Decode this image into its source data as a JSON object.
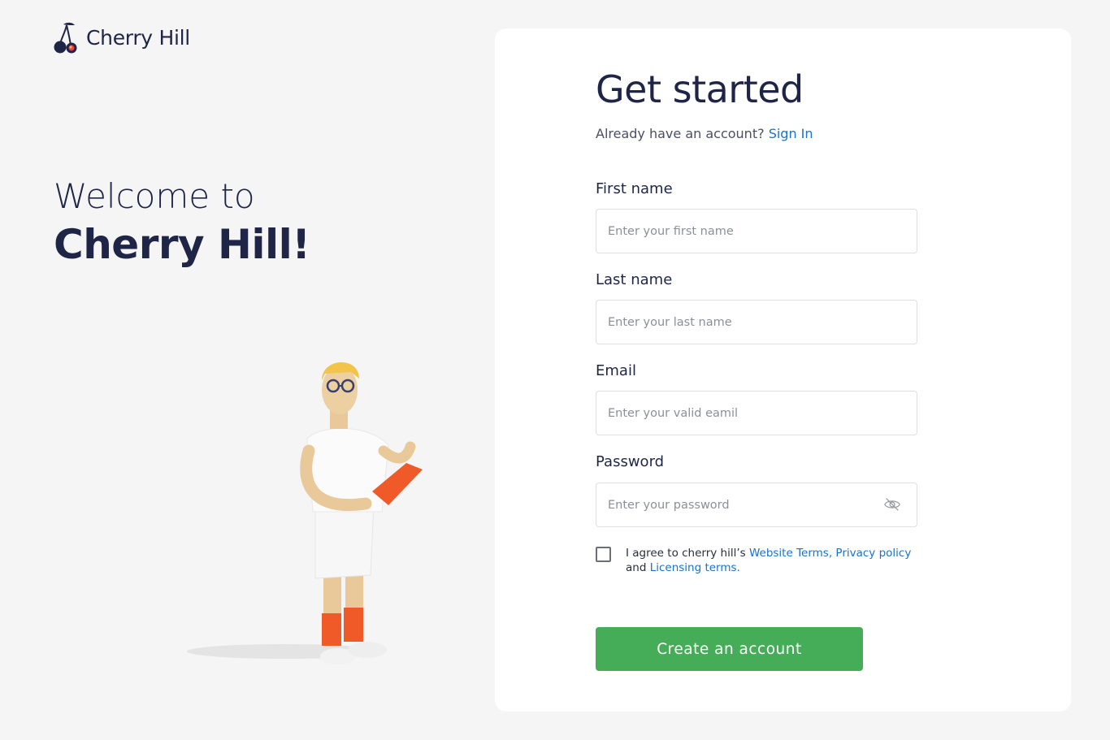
{
  "brand": {
    "name": "Cherry Hill"
  },
  "welcome": {
    "line1": "Welcome to",
    "line2": "Cherry Hill!"
  },
  "form": {
    "title": "Get started",
    "signin_prompt": "Already have an account?",
    "signin_link": "Sign In",
    "fields": [
      {
        "label": "First name",
        "placeholder": "Enter your first name"
      },
      {
        "label": "Last name",
        "placeholder": "Enter your last name"
      },
      {
        "label": "Email",
        "placeholder": "Enter your valid eamil"
      },
      {
        "label": "Password",
        "placeholder": "Enter your password"
      }
    ],
    "agree": {
      "prefix": "I agree to cherry hill’s ",
      "link1": "Website Terms,",
      "link2": "Privacy policy",
      "middle": "and ",
      "link3": "Licensing terms."
    },
    "submit_label": "Create an account"
  },
  "colors": {
    "background": "#f5f5f5",
    "card": "#ffffff",
    "text_primary": "#1f2547",
    "link": "#1a73c9",
    "button": "#45ad58",
    "figure_accent": "#f05a28"
  },
  "icons": {
    "logo": "cherry-icon",
    "password_toggle": "eye-off-icon"
  }
}
